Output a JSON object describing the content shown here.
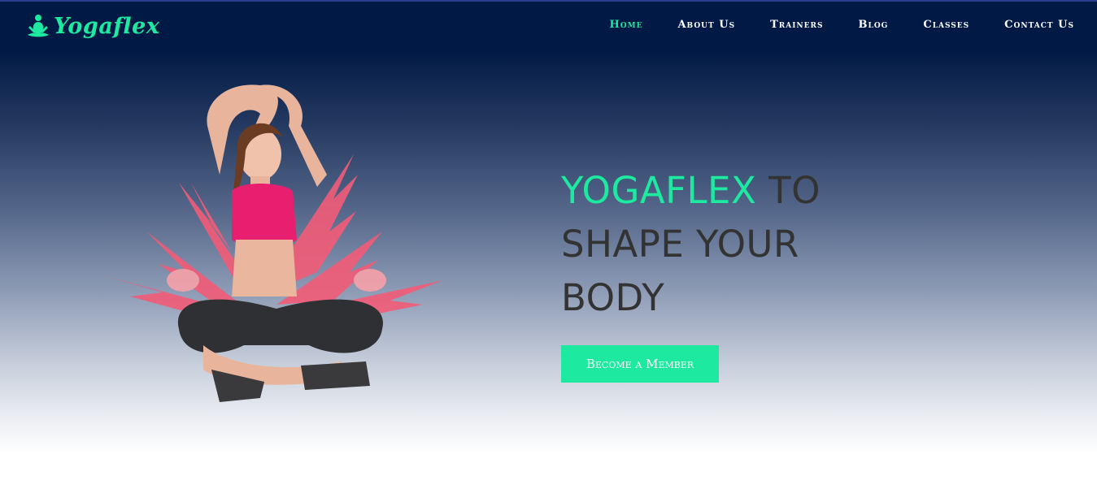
{
  "brand": {
    "name": "Yogaflex",
    "icon": "meditation-logo-icon",
    "accent_color": "#1de9a0",
    "header_color": "#011a45"
  },
  "nav": {
    "items": [
      {
        "label": "Home",
        "active": true
      },
      {
        "label": "About Us",
        "active": false
      },
      {
        "label": "Trainers",
        "active": false
      },
      {
        "label": "Blog",
        "active": false
      },
      {
        "label": "Classes",
        "active": false
      },
      {
        "label": "Contact Us",
        "active": false
      }
    ]
  },
  "hero": {
    "headline_accent": "YOGAFLEX",
    "headline_line1_rest": " TO",
    "headline_line2": "SHAPE YOUR",
    "headline_line3": "BODY",
    "cta_label": "Become a Member",
    "image": "woman-yoga-pose-with-pink-leaves"
  }
}
